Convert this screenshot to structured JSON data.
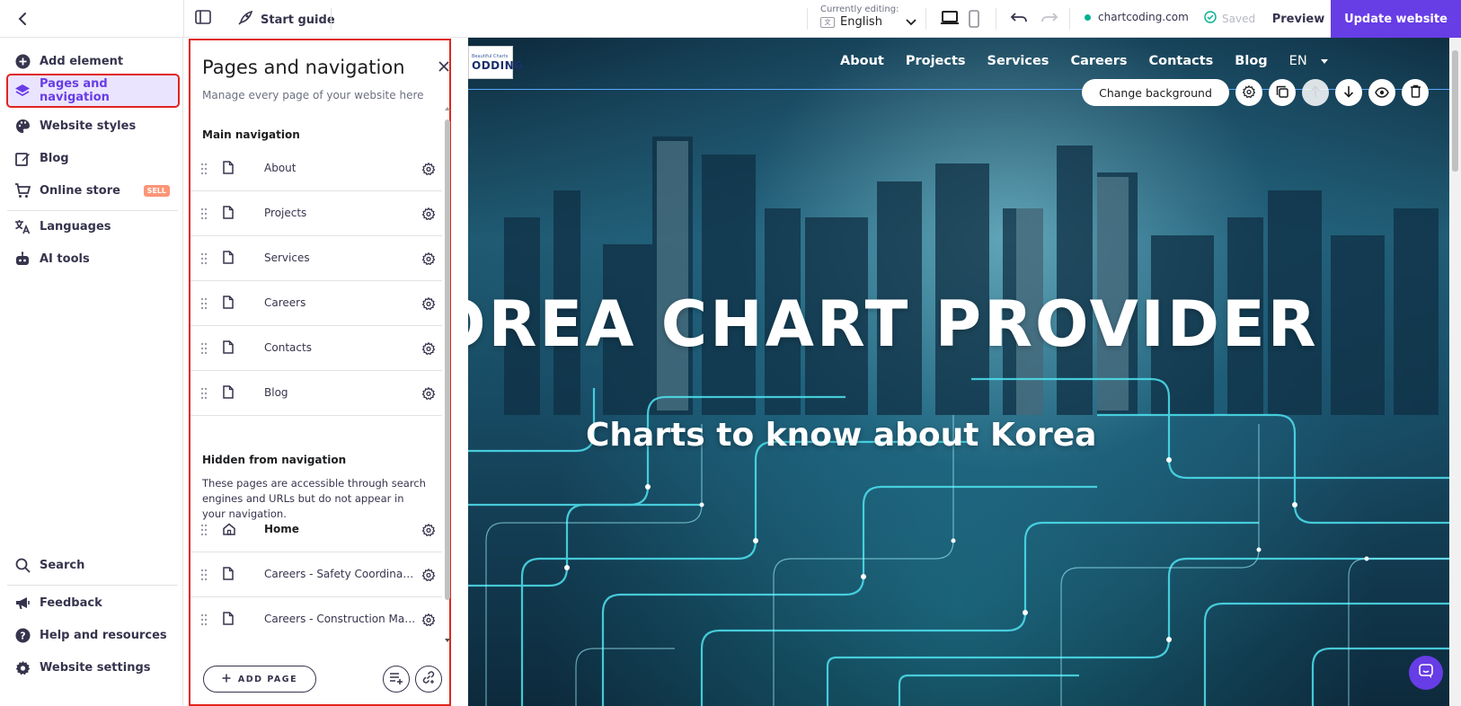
{
  "topbar": {
    "start_guide": "Start guide",
    "editing_caption": "Currently editing:",
    "editing_language": "English",
    "domain": "chartcoding.com",
    "saved": "Saved",
    "preview": "Preview",
    "update": "Update website"
  },
  "sidebar": {
    "items": [
      {
        "label": "Add element",
        "icon": "plus-circle-icon"
      },
      {
        "label": "Pages and navigation",
        "icon": "layers-icon"
      },
      {
        "label": "Website styles",
        "icon": "palette-icon"
      },
      {
        "label": "Blog",
        "icon": "edit-icon"
      },
      {
        "label": "Online store",
        "icon": "cart-icon",
        "badge": "SELL"
      },
      {
        "label": "Languages",
        "icon": "translate-icon"
      },
      {
        "label": "AI tools",
        "icon": "robot-icon"
      }
    ],
    "bottom": [
      {
        "label": "Search",
        "icon": "search-icon"
      },
      {
        "label": "Feedback",
        "icon": "megaphone-icon"
      },
      {
        "label": "Help and resources",
        "icon": "help-icon"
      },
      {
        "label": "Website settings",
        "icon": "gear-icon"
      }
    ]
  },
  "panel": {
    "title": "Pages and navigation",
    "subtitle": "Manage every page of your website here",
    "main_heading": "Main navigation",
    "main_pages": [
      "About",
      "Projects",
      "Services",
      "Careers",
      "Contacts",
      "Blog"
    ],
    "hidden_heading": "Hidden from navigation",
    "hidden_desc": "These pages are accessible through search engines and URLs but do not appear in your navigation.",
    "hidden_pages": [
      "Home",
      "Careers - Safety Coordinator",
      "Careers - Construction Mana..."
    ],
    "add_page": "ADD PAGE"
  },
  "site": {
    "logo_small": "Beautiful Charts",
    "logo_big": "ODDING",
    "nav": [
      "About",
      "Projects",
      "Services",
      "Careers",
      "Contacts",
      "Blog"
    ],
    "lang": "EN",
    "change_background": "Change background",
    "hero_title": "OREA CHART PROVIDER",
    "hero_subtitle": "Charts to know about Korea"
  },
  "colors": {
    "accent": "#673de6",
    "highlight_border": "#e0251d",
    "active_bg": "#ebe4ff"
  }
}
